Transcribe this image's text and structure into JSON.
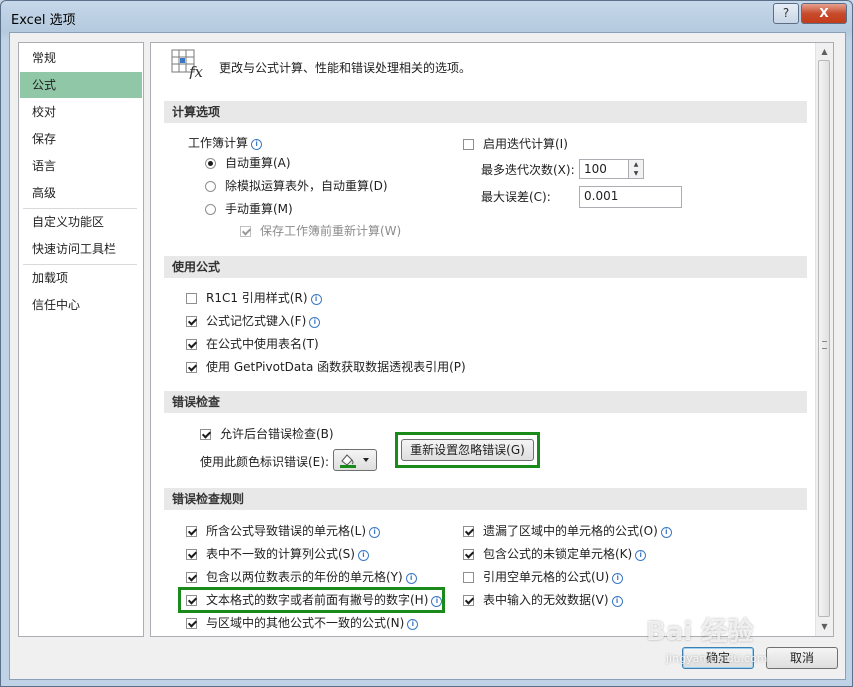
{
  "window": {
    "title": "Excel 选项",
    "help_label": "?",
    "close_label": "X"
  },
  "sidebar": {
    "items": [
      {
        "label": "常规"
      },
      {
        "label": "公式"
      },
      {
        "label": "校对"
      },
      {
        "label": "保存"
      },
      {
        "label": "语言"
      },
      {
        "label": "高级"
      },
      {
        "label": "自定义功能区"
      },
      {
        "label": "快速访问工具栏"
      },
      {
        "label": "加载项"
      },
      {
        "label": "信任中心"
      }
    ],
    "selected": "公式"
  },
  "header": {
    "text": "更改与公式计算、性能和错误处理相关的选项。",
    "icon": "fx-formula-icon"
  },
  "calc": {
    "section_title": "计算选项",
    "workbook_label": "工作簿计算",
    "auto": "自动重算(A)",
    "auto_except_tables": "除模拟运算表外，自动重算(D)",
    "manual": "手动重算(M)",
    "recalc_before_save": "保存工作簿前重新计算(W)",
    "enable_iterative": "启用迭代计算(I)",
    "max_iterations_label": "最多迭代次数(X):",
    "max_iterations_value": "100",
    "max_change_label": "最大误差(C):",
    "max_change_value": "0.001"
  },
  "formulas": {
    "section_title": "使用公式",
    "r1c1": "R1C1 引用样式(R)",
    "autocomplete": "公式记忆式键入(F)",
    "table_names": "在公式中使用表名(T)",
    "getpivotdata": "使用 GetPivotData 函数获取数据透视表引用(P)"
  },
  "error_check": {
    "section_title": "错误检查",
    "background": "允许后台错误检查(B)",
    "color_label": "使用此颜色标识错误(E):",
    "reset_button": "重新设置忽略错误(G)",
    "indicator_color": "#1a8a1a"
  },
  "rules": {
    "section_title": "错误检查规则",
    "left": [
      {
        "label": "所含公式导致错误的单元格(L)",
        "checked": true
      },
      {
        "label": "表中不一致的计算列公式(S)",
        "checked": true
      },
      {
        "label": "包含以两位数表示的年份的单元格(Y)",
        "checked": true
      },
      {
        "label": "文本格式的数字或者前面有撇号的数字(H)",
        "checked": true
      },
      {
        "label": "与区域中的其他公式不一致的公式(N)",
        "checked": true
      }
    ],
    "right": [
      {
        "label": "遗漏了区域中的单元格的公式(O)",
        "checked": true
      },
      {
        "label": "包含公式的未锁定单元格(K)",
        "checked": true
      },
      {
        "label": "引用空单元格的公式(U)",
        "checked": false
      },
      {
        "label": "表中输入的无效数据(V)",
        "checked": true
      }
    ]
  },
  "footer": {
    "ok": "确定",
    "cancel": "取消"
  },
  "watermark": {
    "main": "Bai 经验",
    "sub": "jingyan.baidu.com"
  }
}
